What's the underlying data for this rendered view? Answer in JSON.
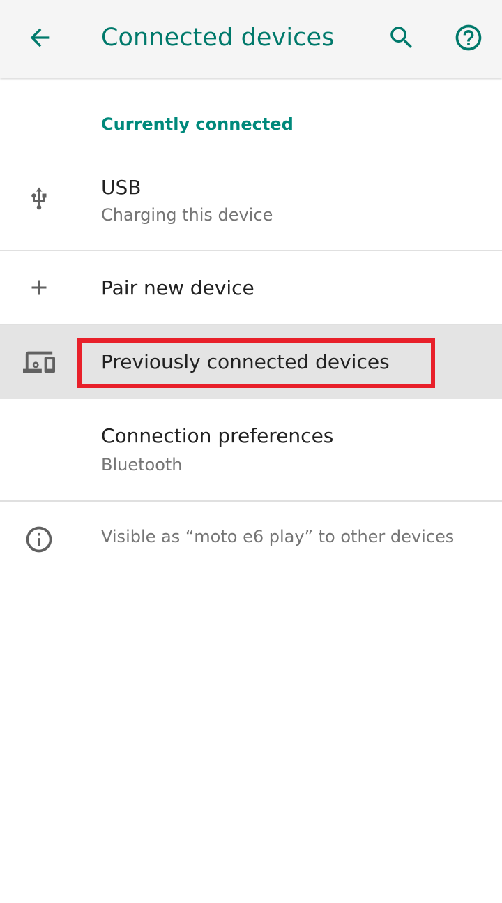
{
  "app_bar": {
    "title": "Connected devices",
    "back_icon": "arrow-back-icon",
    "search_icon": "search-icon",
    "help_icon": "help-icon",
    "accent_color": "#00796b"
  },
  "sections": {
    "currently_connected_header": "Currently connected"
  },
  "rows": {
    "usb": {
      "title": "USB",
      "subtitle": "Charging this device",
      "icon": "usb-icon"
    },
    "pair": {
      "title": "Pair new device",
      "icon": "plus-icon"
    },
    "previously": {
      "title": "Previously connected devices",
      "icon": "devices-icon"
    },
    "preferences": {
      "title": "Connection preferences",
      "subtitle": "Bluetooth"
    },
    "info": {
      "text": "Visible as “moto e6 play” to other devices",
      "icon": "info-icon"
    }
  },
  "highlight_color": "#e8202a"
}
